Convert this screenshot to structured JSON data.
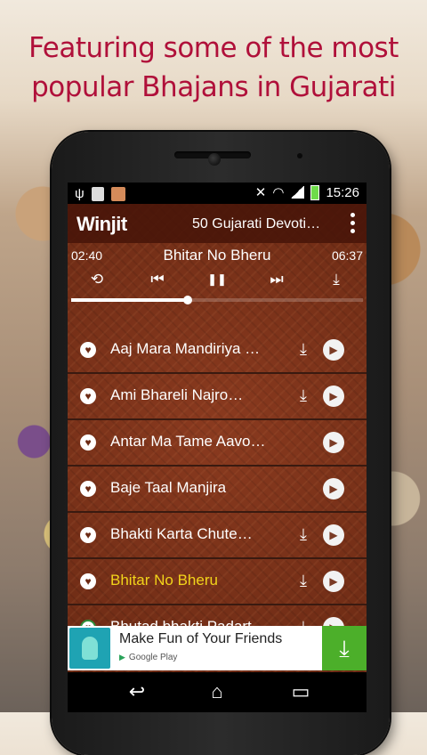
{
  "promo": {
    "headline_line1": "Featuring some of the most",
    "headline_line2": "popular Bhajans in Gujarati"
  },
  "statusbar": {
    "time": "15:26",
    "icons": [
      "usb-icon",
      "bbc-icon",
      "notification-icon",
      "mute-icon",
      "wifi-icon",
      "signal-icon",
      "battery-icon"
    ]
  },
  "appbar": {
    "logo": "Winjit",
    "title": "50 Gujarati Devoti…"
  },
  "player": {
    "current_time": "02:40",
    "total_time": "06:37",
    "now_playing": "Bhitar No Bheru",
    "progress": 0.4,
    "controls": {
      "repeat": "⟲",
      "prev": "⏮",
      "pause": "❚❚",
      "next": "⏭",
      "download": "⤓"
    }
  },
  "songs": [
    {
      "title": "Aaj Mara Mandiriya …",
      "download": true,
      "active": false
    },
    {
      "title": "Ami Bhareli Najro…",
      "download": true,
      "active": false
    },
    {
      "title": "Antar Ma Tame Aavo…",
      "download": false,
      "active": false
    },
    {
      "title": "Baje Taal Manjira",
      "download": false,
      "active": false
    },
    {
      "title": "Bhakti Karta Chute…",
      "download": true,
      "active": false
    },
    {
      "title": "Bhitar No Bheru",
      "download": true,
      "active": true
    },
    {
      "title": "Bhutad bhakti Padart…",
      "download": true,
      "active": false
    }
  ],
  "ad": {
    "title": "Make Fun of Your Friends",
    "store": "Google Play",
    "button": "⤓"
  },
  "nav": {
    "back": "↩",
    "home": "⌂",
    "recents": "▭"
  },
  "colors": {
    "headline": "#b0103a",
    "active_song": "#f2d41a",
    "ad_button": "#4caf2a"
  }
}
